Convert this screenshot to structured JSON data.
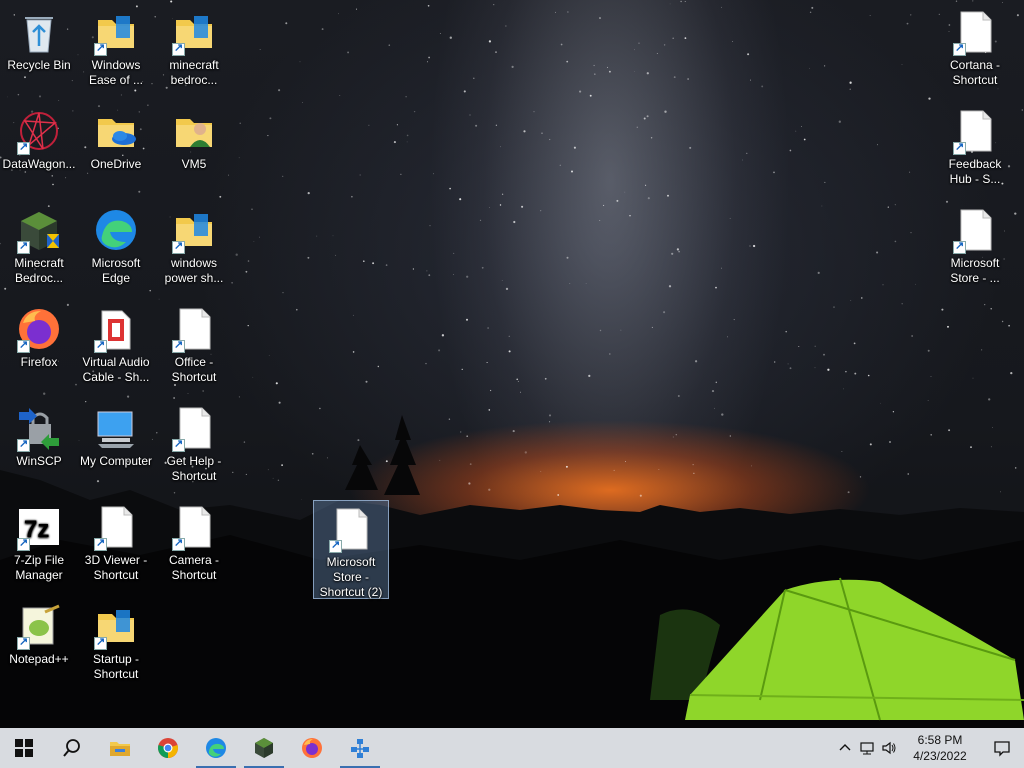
{
  "desktop": {
    "icons_left": [
      {
        "label": "Recycle Bin",
        "icon": "recycle-bin-icon"
      },
      {
        "label": "Windows Ease of ...",
        "icon": "folder-icon"
      },
      {
        "label": "minecraft bedroc...",
        "icon": "folder-icon"
      },
      {
        "label": "DataWagon...",
        "icon": "datawagon-icon"
      },
      {
        "label": "OneDrive",
        "icon": "onedrive-folder-icon"
      },
      {
        "label": "VM5",
        "icon": "user-folder-icon"
      },
      {
        "label": "Minecraft Bedroc...",
        "icon": "minecraft-icon"
      },
      {
        "label": "Microsoft Edge",
        "icon": "edge-icon"
      },
      {
        "label": "windows power sh...",
        "icon": "folder-icon"
      },
      {
        "label": "Firefox",
        "icon": "firefox-icon"
      },
      {
        "label": "Virtual Audio Cable - Sh...",
        "icon": "audio-cable-icon"
      },
      {
        "label": "Office - Shortcut",
        "icon": "blank-file-icon"
      },
      {
        "label": "WinSCP",
        "icon": "winscp-icon"
      },
      {
        "label": "My Computer",
        "icon": "computer-icon"
      },
      {
        "label": "Get Help - Shortcut",
        "icon": "blank-file-icon"
      },
      {
        "label": "7-Zip File Manager",
        "icon": "seven-zip-icon"
      },
      {
        "label": "3D Viewer - Shortcut",
        "icon": "blank-file-icon"
      },
      {
        "label": "Camera - Shortcut",
        "icon": "blank-file-icon"
      },
      {
        "label": "Notepad++",
        "icon": "notepad-plus-icon"
      },
      {
        "label": "Startup - Shortcut",
        "icon": "folder-icon"
      }
    ],
    "icons_right": [
      {
        "label": "Cortana - Shortcut",
        "icon": "blank-file-icon"
      },
      {
        "label": "Feedback Hub - S...",
        "icon": "blank-file-icon"
      },
      {
        "label": "Microsoft Store - ...",
        "icon": "blank-file-icon"
      }
    ],
    "selected_icon": {
      "label": "Microsoft Store - Shortcut (2)",
      "icon": "blank-file-icon"
    }
  },
  "taskbar": {
    "start": "windows-start-icon",
    "search": "search-icon",
    "pinned": [
      "file-explorer-icon",
      "chrome-icon",
      "edge-icon",
      "minecraft-icon",
      "firefox-icon",
      "network-app-icon"
    ],
    "tray": {
      "time": "6:58 PM",
      "date": "4/23/2022"
    }
  },
  "colors": {
    "taskbar_bg": "#d8dbe0",
    "selection": "#78a0d2",
    "tent_green": "#8fd62a"
  }
}
